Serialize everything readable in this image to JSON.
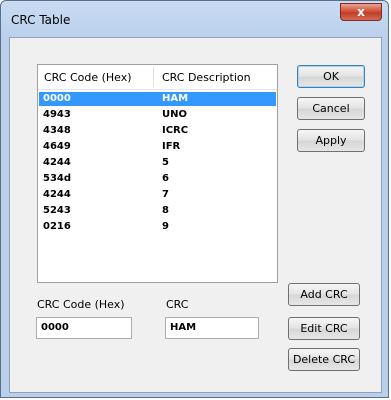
{
  "window": {
    "title": "CRC Table",
    "close_glyph": "x"
  },
  "table": {
    "columns": [
      "CRC Code (Hex)",
      "CRC Description"
    ],
    "rows": [
      {
        "code": "0000",
        "desc": "HAM",
        "selected": true
      },
      {
        "code": "4943",
        "desc": "UNO"
      },
      {
        "code": "4348",
        "desc": "ICRC"
      },
      {
        "code": "4649",
        "desc": "IFR"
      },
      {
        "code": "4244",
        "desc": "5"
      },
      {
        "code": "534d",
        "desc": "6"
      },
      {
        "code": "4244",
        "desc": "7"
      },
      {
        "code": "5243",
        "desc": "8"
      },
      {
        "code": "0216",
        "desc": "9"
      }
    ]
  },
  "buttons": {
    "ok": "OK",
    "cancel": "Cancel",
    "apply": "Apply",
    "add_crc": "Add CRC",
    "edit_crc": "Edit CRC",
    "delete_crc": "Delete CRC"
  },
  "fields": {
    "code_label": "CRC Code (Hex)",
    "code_value": "0000",
    "crc_label": "CRC",
    "crc_value": "HAM"
  },
  "colors": {
    "selection": "#3399ff",
    "titlebar": "#b9cfeb",
    "close_button": "#c13e28"
  }
}
